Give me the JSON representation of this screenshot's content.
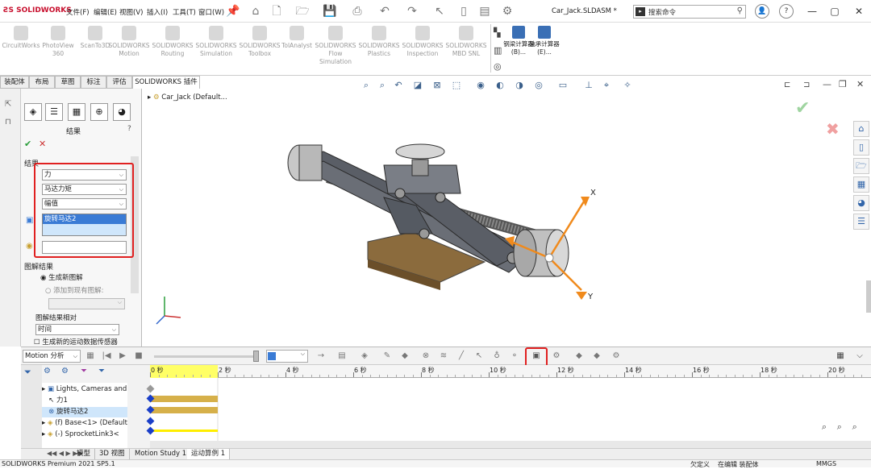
{
  "app": {
    "logo": "SOLIDWORKS",
    "doc_title": "Car_Jack.SLDASM *"
  },
  "menu": [
    "文件(F)",
    "编辑(E)",
    "视图(V)",
    "插入(I)",
    "工具(T)",
    "窗口(W)"
  ],
  "search": {
    "placeholder": "搜索命令"
  },
  "ribbon": {
    "addins": [
      {
        "label": "CircuitWorks"
      },
      {
        "label": "PhotoView 360"
      },
      {
        "label": "ScanTo3D"
      },
      {
        "label": "SOLIDWORKS Motion"
      },
      {
        "label": "SOLIDWORKS Routing"
      },
      {
        "label": "SOLIDWORKS Simulation"
      },
      {
        "label": "SOLIDWORKS Toolbox"
      },
      {
        "label": "TolAnalyst"
      },
      {
        "label": "SOLIDWORKS Flow Simulation"
      },
      {
        "label": "SOLIDWORKS Plastics"
      },
      {
        "label": "SOLIDWORKS Inspection"
      },
      {
        "label": "SOLIDWORKS MBD SNL"
      }
    ],
    "calc": [
      {
        "label": "钢梁计算器 (B)..."
      },
      {
        "label": "轴承计算器 (E)..."
      }
    ]
  },
  "tabs": [
    "装配体",
    "布局",
    "草图",
    "标注",
    "评估",
    "SOLIDWORKS 插件"
  ],
  "property_manager": {
    "title": "结果",
    "help": "?",
    "section_results": "结果",
    "dd1": "力",
    "dd2": "马达力矩",
    "dd3": "幅值",
    "selected_item": "旋转马达2",
    "section_plot": "图解结果",
    "radio1": "生成新图解",
    "radio2": "添加到现有图解:",
    "plot_relative": "图解结果相对",
    "dd_time": "时间",
    "checkbox": "生成新的运动数据传感器"
  },
  "viewport": {
    "tree_root": "Car_Jack  (Default...",
    "axis_x": "X",
    "axis_y": "Y"
  },
  "motion": {
    "study_type": "Motion 分析",
    "tree": [
      {
        "label": "Lights, Cameras and"
      },
      {
        "label": "力1"
      },
      {
        "label": "旋转马达2"
      },
      {
        "label": "(f) Base<1> (Default"
      },
      {
        "label": "(-) SprocketLink3<"
      }
    ],
    "ruler": [
      "0 秒",
      "2 秒",
      "4 秒",
      "6 秒",
      "8 秒",
      "10 秒",
      "12 秒",
      "14 秒",
      "16 秒",
      "18 秒",
      "20 秒"
    ]
  },
  "bottom_tabs": [
    "模型",
    "3D 视图",
    "Motion Study 1",
    "运动算例 1"
  ],
  "status": {
    "left": "SOLIDWORKS Premium 2021 SP5.1",
    "mid1": "欠定义",
    "mid2": "在编辑 装配体",
    "units": "MMGS"
  }
}
